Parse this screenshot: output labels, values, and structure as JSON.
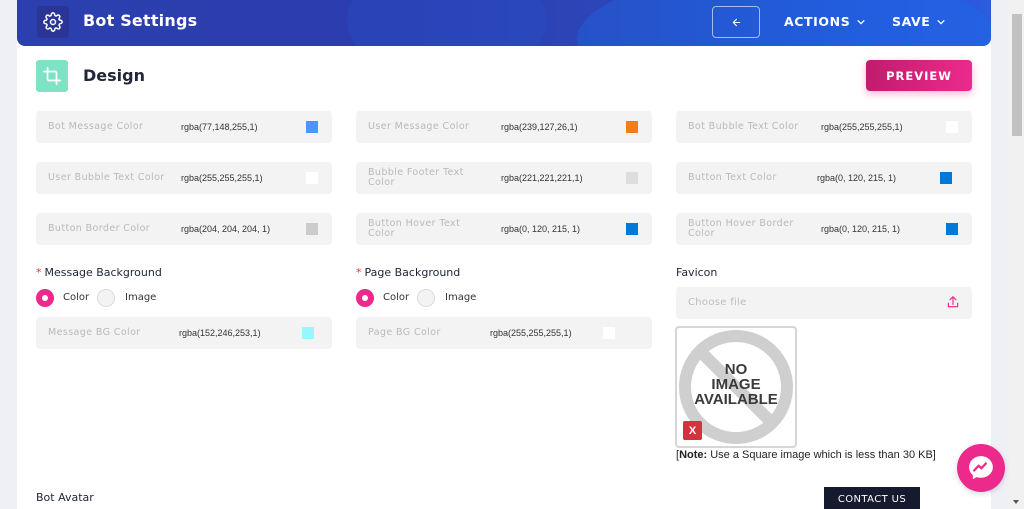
{
  "header": {
    "title": "Bot Settings",
    "back_icon": "arrow-left-icon",
    "actions_label": "ACTIONS",
    "save_label": "SAVE"
  },
  "section": {
    "title": "Design",
    "icon": "crop-icon",
    "preview_label": "PREVIEW"
  },
  "color_fields": [
    {
      "label": "Bot Message Color",
      "value": "rgba(77,148,255,1)",
      "swatch": "#4d94ff"
    },
    {
      "label": "User Message Color",
      "value": "rgba(239,127,26,1)",
      "swatch": "#ef7f1a"
    },
    {
      "label": "Bot Bubble Text Color",
      "value": "rgba(255,255,255,1)",
      "swatch": "#ffffff"
    },
    {
      "label": "User Bubble Text Color",
      "value": "rgba(255,255,255,1)",
      "swatch": "#ffffff"
    },
    {
      "label": "Bubble Footer Text Color",
      "value": "rgba(221,221,221,1)",
      "swatch": "#dddddd"
    },
    {
      "label": "Button Text Color",
      "value": "rgba(0, 120, 215, 1)",
      "swatch": "#0078d7"
    },
    {
      "label": "Button Border Color",
      "value": "rgba(204, 204, 204, 1)",
      "swatch": "#cccccc"
    },
    {
      "label": "Button Hover Text Color",
      "value": "rgba(0, 120, 215, 1)",
      "swatch": "#0078d7"
    },
    {
      "label": "Button Hover Border Color",
      "value": "rgba(0, 120, 215, 1)",
      "swatch": "#0078d7"
    }
  ],
  "message_background": {
    "label": "Message Background",
    "options": [
      "Color",
      "Image"
    ],
    "selected": "Color",
    "field": {
      "label": "Message BG Color",
      "value": "rgba(152,246,253,1)",
      "swatch": "#98f6fd"
    }
  },
  "page_background": {
    "label": "Page Background",
    "options": [
      "Color",
      "Image"
    ],
    "selected": "Color",
    "field": {
      "label": "Page BG Color",
      "value": "rgba(255,255,255,1)",
      "swatch": "#ffffff"
    }
  },
  "favicon": {
    "label": "Favicon",
    "placeholder": "Choose file",
    "preview_text": [
      "NO",
      "IMAGE",
      "AVAILABLE"
    ],
    "remove_label": "X",
    "note_bold": "Note:",
    "note_text": " Use a Square image which is less than 30 KB]",
    "note_open": "["
  },
  "bot_avatar_label": "Bot Avatar",
  "contact_label": "CONTACT US",
  "colors": {
    "accent": "#ec2a8c",
    "header": "#2c3eaf",
    "design_icon_bg": "#7de3c4"
  }
}
